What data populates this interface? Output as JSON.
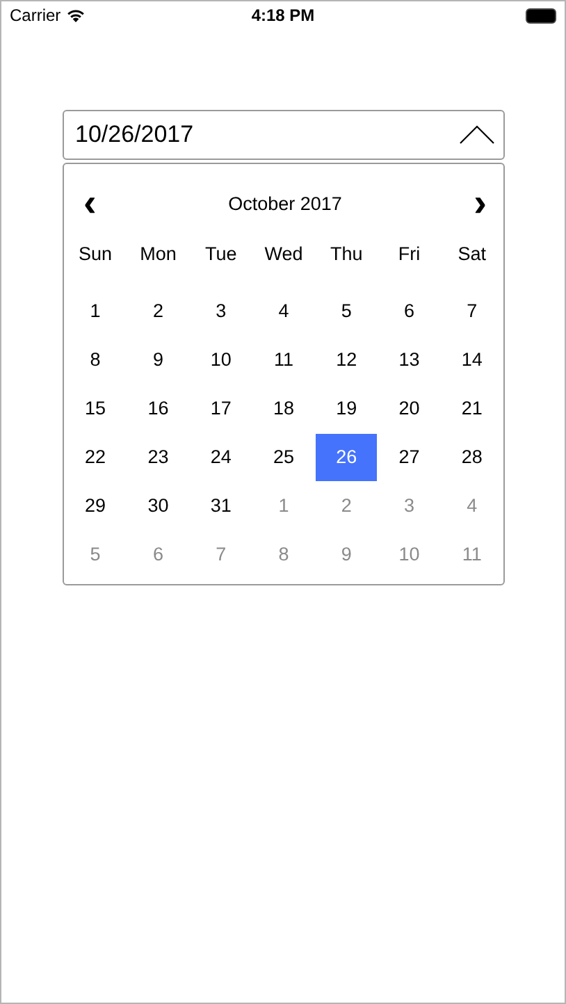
{
  "status_bar": {
    "carrier": "Carrier",
    "time": "4:18 PM"
  },
  "date_field": {
    "value": "10/26/2017",
    "expanded": true
  },
  "calendar": {
    "month_title": "October 2017",
    "prev": "‹",
    "next": "›",
    "weekdays": [
      "Sun",
      "Mon",
      "Tue",
      "Wed",
      "Thu",
      "Fri",
      "Sat"
    ],
    "weeks": [
      [
        {
          "label": "1",
          "selected": false,
          "outside": false
        },
        {
          "label": "2",
          "selected": false,
          "outside": false
        },
        {
          "label": "3",
          "selected": false,
          "outside": false
        },
        {
          "label": "4",
          "selected": false,
          "outside": false
        },
        {
          "label": "5",
          "selected": false,
          "outside": false
        },
        {
          "label": "6",
          "selected": false,
          "outside": false
        },
        {
          "label": "7",
          "selected": false,
          "outside": false
        }
      ],
      [
        {
          "label": "8",
          "selected": false,
          "outside": false
        },
        {
          "label": "9",
          "selected": false,
          "outside": false
        },
        {
          "label": "10",
          "selected": false,
          "outside": false
        },
        {
          "label": "11",
          "selected": false,
          "outside": false
        },
        {
          "label": "12",
          "selected": false,
          "outside": false
        },
        {
          "label": "13",
          "selected": false,
          "outside": false
        },
        {
          "label": "14",
          "selected": false,
          "outside": false
        }
      ],
      [
        {
          "label": "15",
          "selected": false,
          "outside": false
        },
        {
          "label": "16",
          "selected": false,
          "outside": false
        },
        {
          "label": "17",
          "selected": false,
          "outside": false
        },
        {
          "label": "18",
          "selected": false,
          "outside": false
        },
        {
          "label": "19",
          "selected": false,
          "outside": false
        },
        {
          "label": "20",
          "selected": false,
          "outside": false
        },
        {
          "label": "21",
          "selected": false,
          "outside": false
        }
      ],
      [
        {
          "label": "22",
          "selected": false,
          "outside": false
        },
        {
          "label": "23",
          "selected": false,
          "outside": false
        },
        {
          "label": "24",
          "selected": false,
          "outside": false
        },
        {
          "label": "25",
          "selected": false,
          "outside": false
        },
        {
          "label": "26",
          "selected": true,
          "outside": false
        },
        {
          "label": "27",
          "selected": false,
          "outside": false
        },
        {
          "label": "28",
          "selected": false,
          "outside": false
        }
      ],
      [
        {
          "label": "29",
          "selected": false,
          "outside": false
        },
        {
          "label": "30",
          "selected": false,
          "outside": false
        },
        {
          "label": "31",
          "selected": false,
          "outside": false
        },
        {
          "label": "1",
          "selected": false,
          "outside": true
        },
        {
          "label": "2",
          "selected": false,
          "outside": true
        },
        {
          "label": "3",
          "selected": false,
          "outside": true
        },
        {
          "label": "4",
          "selected": false,
          "outside": true
        }
      ],
      [
        {
          "label": "5",
          "selected": false,
          "outside": true
        },
        {
          "label": "6",
          "selected": false,
          "outside": true
        },
        {
          "label": "7",
          "selected": false,
          "outside": true
        },
        {
          "label": "8",
          "selected": false,
          "outside": true
        },
        {
          "label": "9",
          "selected": false,
          "outside": true
        },
        {
          "label": "10",
          "selected": false,
          "outside": true
        },
        {
          "label": "11",
          "selected": false,
          "outside": true
        }
      ]
    ]
  }
}
